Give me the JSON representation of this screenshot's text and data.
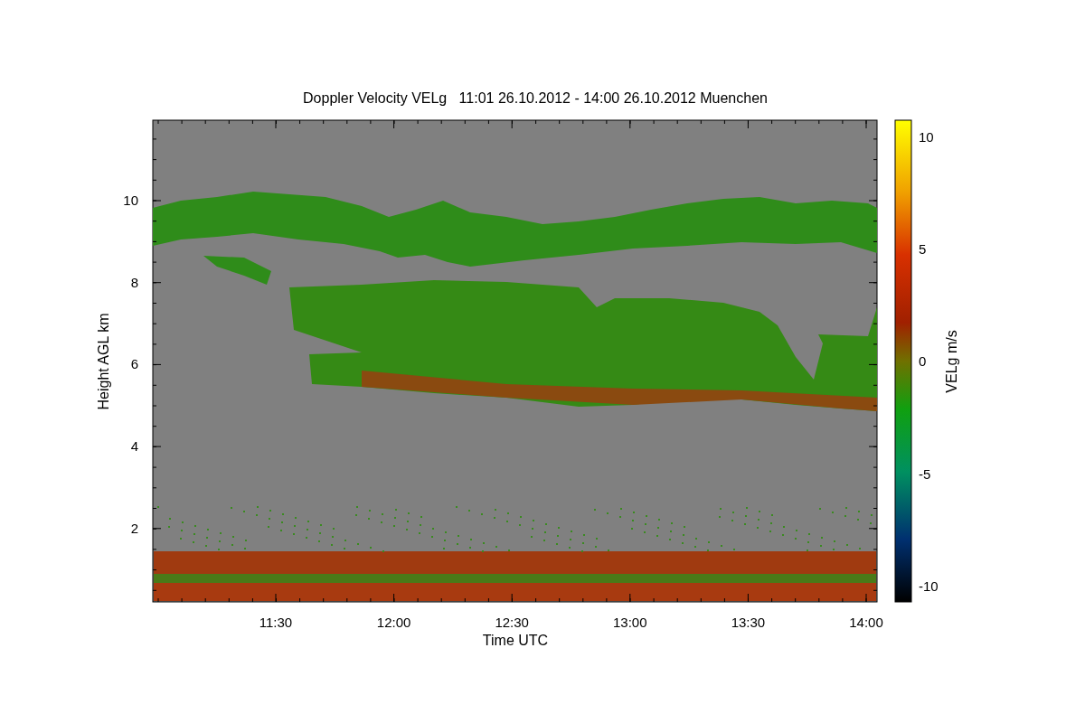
{
  "title": "Doppler Velocity VELg   11:01 26.10.2012 - 14:00 26.10.2012 Muenchen",
  "x_axis": {
    "label": "Time UTC",
    "ticks": [
      "11:30",
      "12:00",
      "12:30",
      "13:00",
      "13:30",
      "14:00"
    ]
  },
  "y_axis": {
    "label": "Height AGL km",
    "ticks": [
      "10",
      "8",
      "6",
      "4",
      "2"
    ]
  },
  "colorbar": {
    "label": "VELg m/s",
    "ticks": [
      "10",
      "5",
      "0",
      "-5",
      "-10"
    ]
  }
}
